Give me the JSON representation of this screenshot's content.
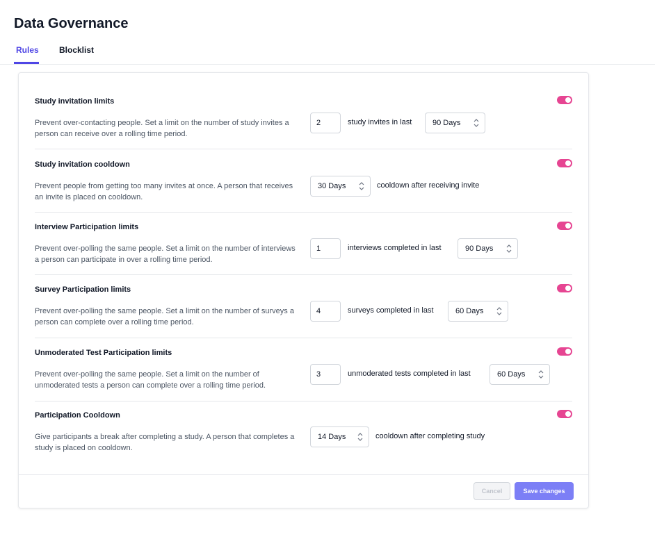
{
  "header": {
    "title": "Data Governance"
  },
  "tabs": [
    {
      "label": "Rules",
      "active": true
    },
    {
      "label": "Blocklist",
      "active": false
    }
  ],
  "rules": [
    {
      "title": "Study invitation limits",
      "description": "Prevent over-contacting people. Set a limit on the number of study invites a person can receive over a rolling time period.",
      "enabled": true,
      "count": "2",
      "middle_text": "study invites in last",
      "period": "90 Days"
    },
    {
      "title": "Study invitation cooldown",
      "description": "Prevent people from getting too many invites at once. A person that receives an invite is placed on cooldown.",
      "enabled": true,
      "period": "30 Days",
      "trailing_text": "cooldown after receiving invite"
    },
    {
      "title": "Interview Participation limits",
      "description": "Prevent over-polling the same people. Set a limit on the number of interviews a person can participate in over a rolling time period.",
      "enabled": true,
      "count": "1",
      "middle_text": "interviews completed in last",
      "period": "90 Days"
    },
    {
      "title": "Survey Participation limits",
      "description": "Prevent over-polling the same people. Set a limit on the number of surveys a person can complete over a rolling time period.",
      "enabled": true,
      "count": "4",
      "middle_text": "surveys completed in last",
      "period": "60 Days"
    },
    {
      "title": "Unmoderated Test Participation limits",
      "description": "Prevent over-polling the same people. Set a limit on the number of unmoderated tests a person can complete over a rolling time period.",
      "enabled": true,
      "count": "3",
      "middle_text": "unmoderated tests completed in last",
      "period": "60 Days"
    },
    {
      "title": "Participation Cooldown",
      "description": "Give participants a break after completing a study. A person that completes a study is placed on cooldown.",
      "enabled": true,
      "period": "14 Days",
      "trailing_text": "cooldown after completing study"
    }
  ],
  "footer": {
    "cancel_label": "Cancel",
    "save_label": "Save changes"
  },
  "colors": {
    "accent": "#4f46e5",
    "toggle_on": "#e64592",
    "primary_button": "#7c7ff6"
  },
  "icons": {
    "select": "chevron-up-down-icon"
  }
}
